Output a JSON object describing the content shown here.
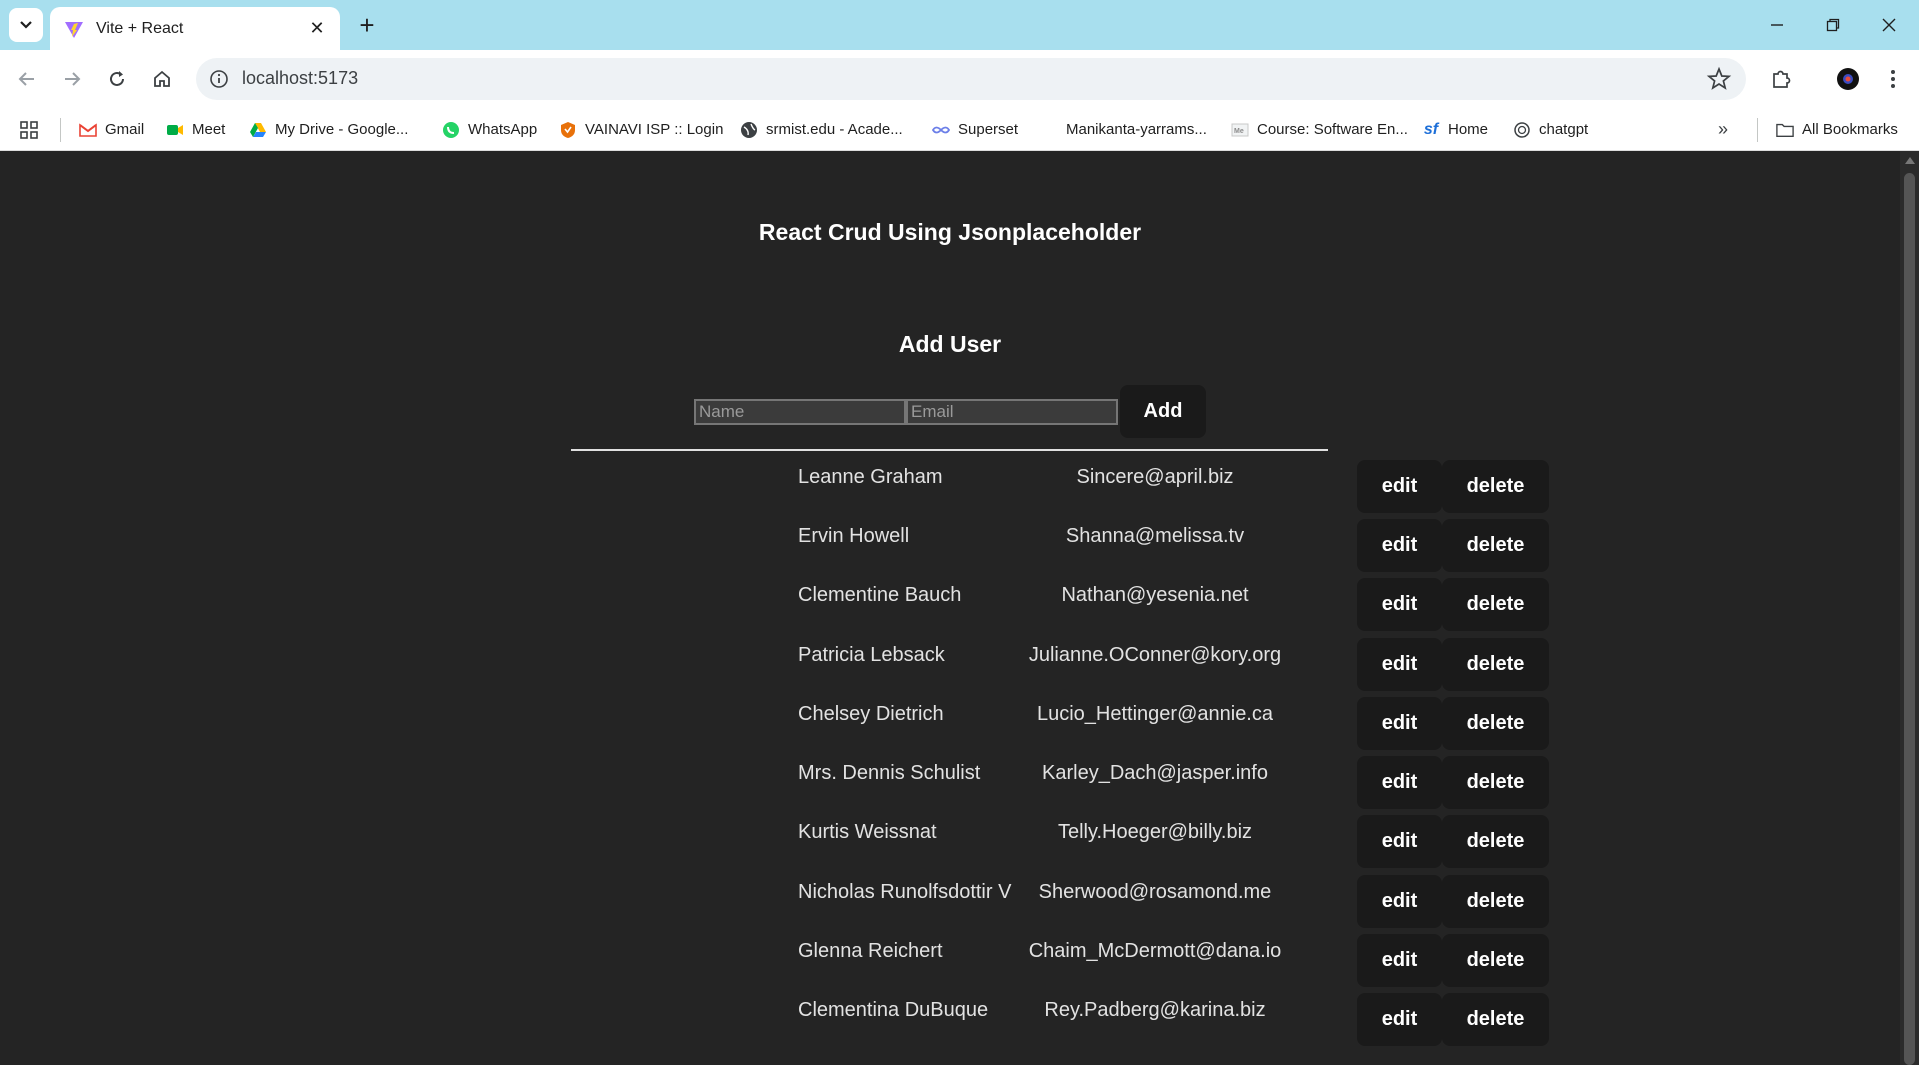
{
  "browser": {
    "tab_title": "Vite + React",
    "url": "localhost:5173",
    "bookmarks": [
      {
        "label": "Gmail",
        "icon": "gmail-icon"
      },
      {
        "label": "Meet",
        "icon": "meet-icon"
      },
      {
        "label": "My Drive - Google...",
        "icon": "drive-icon"
      },
      {
        "label": "WhatsApp",
        "icon": "whatsapp-icon"
      },
      {
        "label": "VAINAVI ISP :: Login",
        "icon": "shield-icon"
      },
      {
        "label": "srmist.edu - Acade...",
        "icon": "globe-icon"
      },
      {
        "label": "Superset",
        "icon": "superset-icon"
      },
      {
        "label": "Manikanta-yarrams...",
        "icon": ""
      },
      {
        "label": "Course: Software En...",
        "icon": "course-icon"
      },
      {
        "label": "Home",
        "icon": "salesforce-icon"
      },
      {
        "label": "chatgpt",
        "icon": "chatgpt-icon"
      }
    ],
    "all_bookmarks_label": "All Bookmarks"
  },
  "app": {
    "title": "React Crud Using Jsonplaceholder",
    "add_heading": "Add User",
    "name_placeholder": "Name",
    "email_placeholder": "Email",
    "add_label": "Add",
    "edit_label": "edit",
    "delete_label": "delete"
  },
  "users": [
    {
      "name": "Leanne Graham",
      "email": "Sincere@april.biz"
    },
    {
      "name": "Ervin Howell",
      "email": "Shanna@melissa.tv"
    },
    {
      "name": "Clementine Bauch",
      "email": "Nathan@yesenia.net"
    },
    {
      "name": "Patricia Lebsack",
      "email": "Julianne.OConner@kory.org"
    },
    {
      "name": "Chelsey Dietrich",
      "email": "Lucio_Hettinger@annie.ca"
    },
    {
      "name": "Mrs. Dennis Schulist",
      "email": "Karley_Dach@jasper.info"
    },
    {
      "name": "Kurtis Weissnat",
      "email": "Telly.Hoeger@billy.biz"
    },
    {
      "name": "Nicholas Runolfsdottir V",
      "email": "Sherwood@rosamond.me"
    },
    {
      "name": "Glenna Reichert",
      "email": "Chaim_McDermott@dana.io"
    },
    {
      "name": "Clementina DuBuque",
      "email": "Rey.Padberg@karina.biz"
    }
  ],
  "colors": {
    "page_bg": "#242424",
    "button_bg": "#1a1a1a",
    "tabstrip_bg": "#a8dfee"
  }
}
